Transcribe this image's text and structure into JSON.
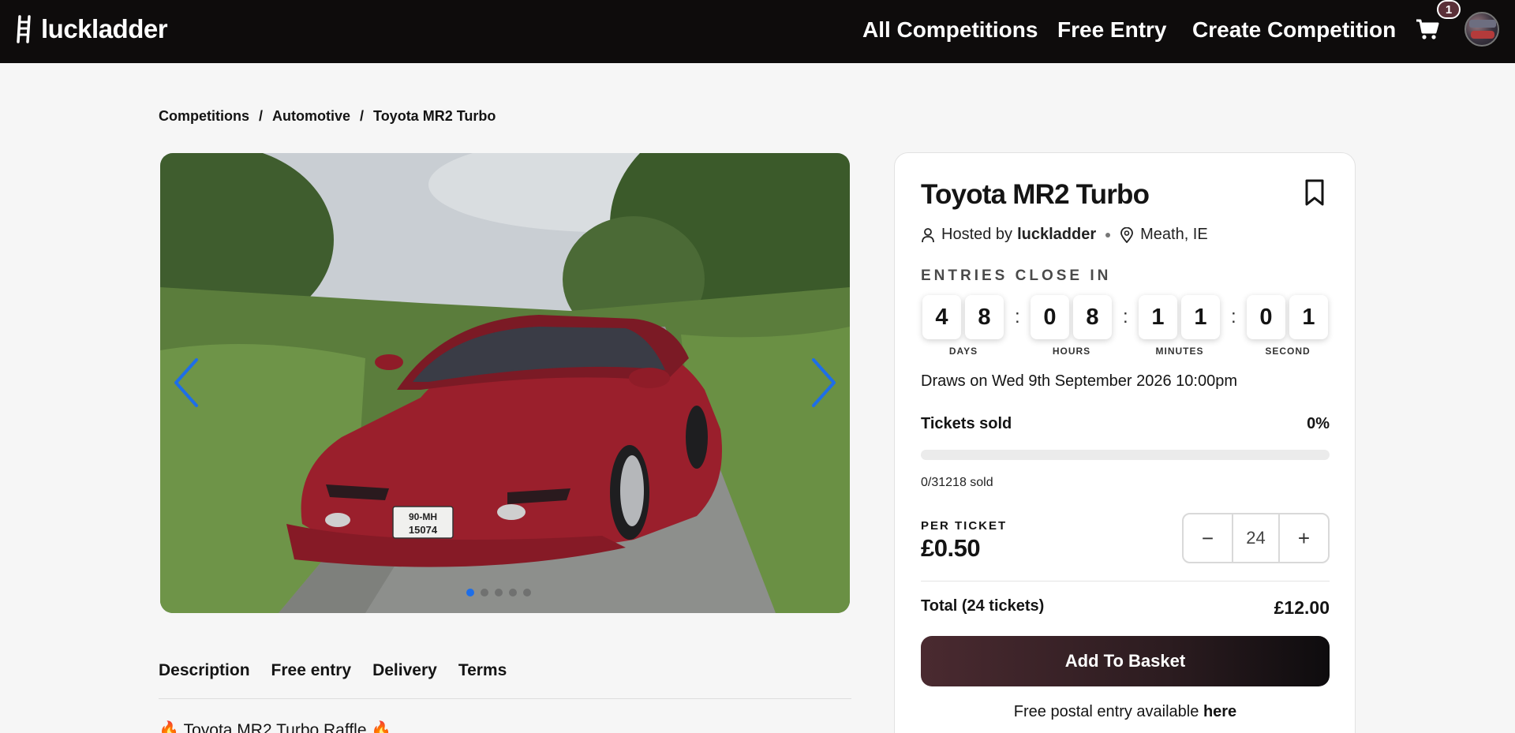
{
  "header": {
    "logo_text": "luckladder",
    "nav": [
      "All Competitions",
      "Free Entry",
      "Create Competition"
    ],
    "cart_count": "1"
  },
  "breadcrumb": [
    "Competitions",
    "Automotive",
    "Toyota MR2 Turbo"
  ],
  "breadcrumb_separator": "/",
  "gallery": {
    "plate_line1": "90-MH",
    "plate_line2": "15074",
    "slides": 5,
    "active_slide": 1
  },
  "tabs": [
    "Description",
    "Free entry",
    "Delivery",
    "Terms"
  ],
  "description_first_line": "🔥 Toyota MR2 Turbo Raffle 🔥",
  "panel": {
    "title": "Toyota MR2 Turbo",
    "hosted_by_label": "Hosted by",
    "host": "luckladder",
    "location": "Meath, IE",
    "entries_close_label": "ENTRIES CLOSE IN",
    "countdown": {
      "days": [
        "4",
        "8"
      ],
      "hours": [
        "0",
        "8"
      ],
      "minutes": [
        "1",
        "1"
      ],
      "seconds": [
        "0",
        "1"
      ],
      "units": [
        "DAYS",
        "HOURS",
        "MINUTES",
        "SECOND"
      ],
      "separator": ":"
    },
    "draws_text": "Draws on Wed 9th September 2026 10:00pm",
    "tickets_sold_label": "Tickets sold",
    "tickets_sold_percent": "0%",
    "tickets_sold_fraction": 0,
    "sold_count_text": "0/31218 sold",
    "per_ticket_label": "PER TICKET",
    "price": "£0.50",
    "quantity": "24",
    "minus_symbol": "−",
    "plus_symbol": "+",
    "total_label": "Total (24 tickets)",
    "total_amount": "£12.00",
    "add_button": "Add To Basket",
    "postal_text": "Free postal entry available",
    "postal_link": "here"
  },
  "colors": {
    "header_bg": "#0e0c0c",
    "carousel_arrow": "#1e6ee8",
    "active_dot": "#1e6ee8",
    "button_dark": "#2c1c20"
  }
}
